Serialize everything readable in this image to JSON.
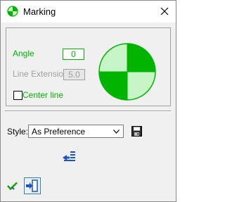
{
  "window": {
    "title": "Marking"
  },
  "form": {
    "angle_label": "Angle",
    "angle_value": "0",
    "line_extension_label": "Line Extension",
    "line_extension_value": "5.0",
    "center_line_label": "Center line",
    "center_line_checked": false
  },
  "style": {
    "label": "Style:",
    "selected": "As Preference"
  },
  "colors": {
    "green": "#00b400",
    "light_green": "#c8f5c8",
    "blue": "#1e50c8"
  },
  "icons": {
    "app": "marking-app-icon",
    "close": "close-icon",
    "save": "save-disk-icon",
    "update": "update-list-icon",
    "ok": "ok-check-icon",
    "exit": "exit-door-icon"
  }
}
